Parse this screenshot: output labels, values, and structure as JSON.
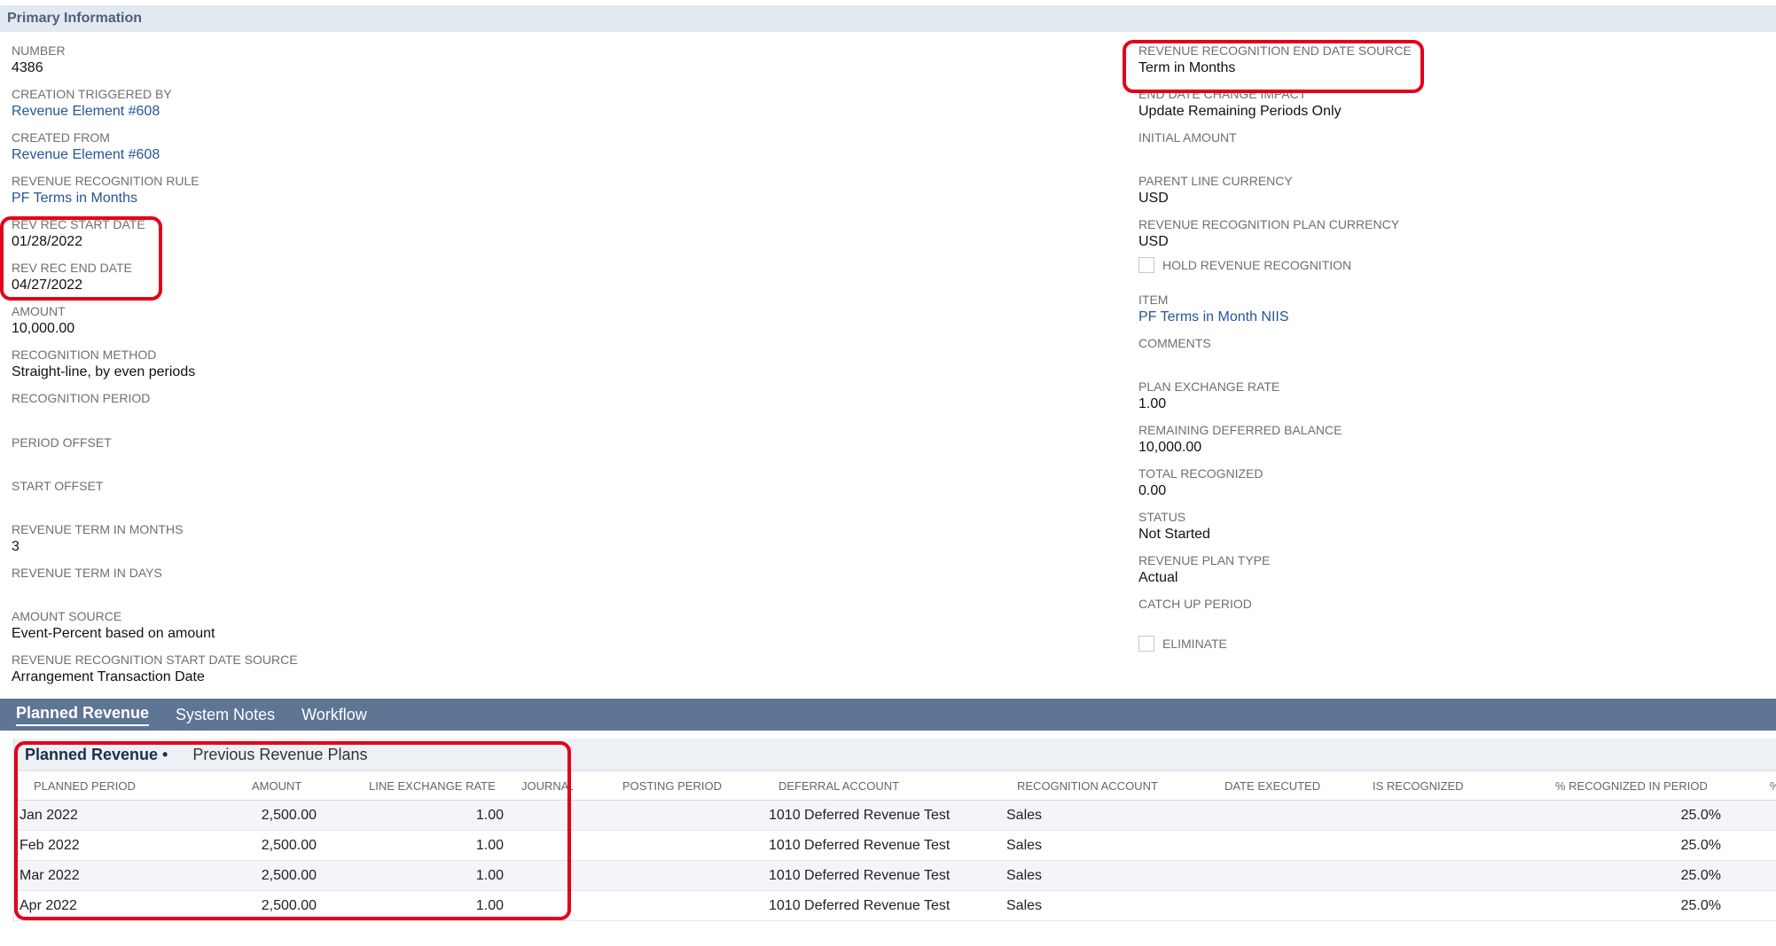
{
  "section_title": "Primary Information",
  "left_fields": [
    {
      "label": "NUMBER",
      "value": "4386",
      "link": false
    },
    {
      "label": "CREATION TRIGGERED BY",
      "value": "Revenue Element #608",
      "link": true
    },
    {
      "label": "CREATED FROM",
      "value": "Revenue Element #608",
      "link": true
    },
    {
      "label": "REVENUE RECOGNITION RULE",
      "value": "PF Terms in Months",
      "link": true
    },
    {
      "label": "REV REC START DATE",
      "value": "01/28/2022",
      "link": false
    },
    {
      "label": "REV REC END DATE",
      "value": "04/27/2022",
      "link": false
    },
    {
      "label": "AMOUNT",
      "value": "10,000.00",
      "link": false
    },
    {
      "label": "RECOGNITION METHOD",
      "value": "Straight-line, by even periods",
      "link": false
    },
    {
      "label": "RECOGNITION PERIOD",
      "value": "",
      "link": false
    },
    {
      "label": "PERIOD OFFSET",
      "value": "",
      "link": false
    },
    {
      "label": "START OFFSET",
      "value": "",
      "link": false
    },
    {
      "label": "REVENUE TERM IN MONTHS",
      "value": "3",
      "link": false
    },
    {
      "label": "REVENUE TERM IN DAYS",
      "value": "",
      "link": false
    },
    {
      "label": "AMOUNT SOURCE",
      "value": "Event-Percent based on amount",
      "link": false
    },
    {
      "label": "REVENUE RECOGNITION START DATE SOURCE",
      "value": "Arrangement Transaction Date",
      "link": false
    }
  ],
  "right_fields": [
    {
      "label": "REVENUE RECOGNITION END DATE SOURCE",
      "value": "Term in Months",
      "link": false
    },
    {
      "label": "END DATE CHANGE IMPACT",
      "value": "Update Remaining Periods Only",
      "link": false
    },
    {
      "label": "INITIAL AMOUNT",
      "value": "",
      "link": false
    },
    {
      "label": "PARENT LINE CURRENCY",
      "value": "USD",
      "link": false
    },
    {
      "label": "REVENUE RECOGNITION PLAN CURRENCY",
      "value": "USD",
      "link": false
    },
    {
      "label": "ITEM",
      "value": "PF Terms in Month NIIS",
      "link": true
    },
    {
      "label": "COMMENTS",
      "value": "",
      "link": false
    },
    {
      "label": "PLAN EXCHANGE RATE",
      "value": "1.00",
      "link": false
    },
    {
      "label": "REMAINING DEFERRED BALANCE",
      "value": "10,000.00",
      "link": false
    },
    {
      "label": "TOTAL RECOGNIZED",
      "value": "0.00",
      "link": false
    },
    {
      "label": "STATUS",
      "value": "Not Started",
      "link": false
    },
    {
      "label": "REVENUE PLAN TYPE",
      "value": "Actual",
      "link": false
    },
    {
      "label": "CATCH UP PERIOD",
      "value": "",
      "link": false
    }
  ],
  "checkboxes": {
    "hold_revenue_recognition": {
      "label": "HOLD REVENUE RECOGNITION",
      "checked": false
    },
    "eliminate": {
      "label": "ELIMINATE",
      "checked": false
    }
  },
  "subtabs": [
    "Planned Revenue",
    "System Notes",
    "Workflow"
  ],
  "inner_tabs": [
    "Planned Revenue •",
    "Previous Revenue Plans"
  ],
  "table": {
    "columns": [
      "PLANNED PERIOD",
      "AMOUNT",
      "LINE EXCHANGE RATE",
      "JOURNAL",
      "POSTING PERIOD",
      "DEFERRAL ACCOUNT",
      "RECOGNITION ACCOUNT",
      "DATE EXECUTED",
      "IS RECOGNIZED",
      "% RECOGNIZED IN PERIOD",
      "%"
    ],
    "rows": [
      [
        "Jan 2022",
        "2,500.00",
        "1.00",
        "",
        "",
        "1010 Deferred Revenue Test",
        "Sales",
        "",
        "",
        "25.0%",
        ""
      ],
      [
        "Feb 2022",
        "2,500.00",
        "1.00",
        "",
        "",
        "1010 Deferred Revenue Test",
        "Sales",
        "",
        "",
        "25.0%",
        ""
      ],
      [
        "Mar 2022",
        "2,500.00",
        "1.00",
        "",
        "",
        "1010 Deferred Revenue Test",
        "Sales",
        "",
        "",
        "25.0%",
        ""
      ],
      [
        "Apr 2022",
        "2,500.00",
        "1.00",
        "",
        "",
        "1010 Deferred Revenue Test",
        "Sales",
        "",
        "",
        "25.0%",
        ""
      ]
    ]
  },
  "colors": {
    "header_bg": "#e3e9f0",
    "subtab_bar": "#5e7594",
    "link": "#255599",
    "highlight": "#e3001b"
  }
}
